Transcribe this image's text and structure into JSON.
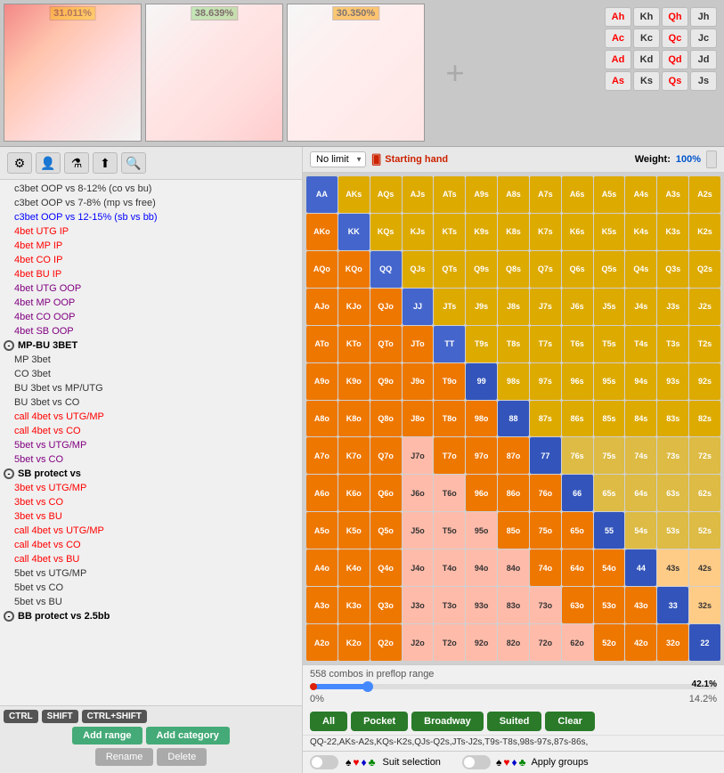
{
  "top": {
    "preview1_label": "31.011%",
    "preview2_label": "38.639%",
    "preview3_label": "30.350%",
    "add_btn": "+"
  },
  "cards": {
    "rows": [
      [
        "Ah",
        "Kh",
        "Qh",
        "Jh"
      ],
      [
        "Ac",
        "Kc",
        "Qc",
        "Jc"
      ],
      [
        "Ad",
        "Kd",
        "Qd",
        "Jd"
      ],
      [
        "As",
        "Ks",
        "Qs",
        "Js"
      ]
    ]
  },
  "toolbar": {
    "limit_label": "No limit",
    "starting_hand_icon": "🃏",
    "starting_hand_label": "Starting hand",
    "weight_label": "Weight:",
    "weight_value": "100%"
  },
  "sidebar": {
    "items": [
      {
        "label": "c3bet OOP vs 8-12% (co vs bu)",
        "color": "default",
        "indent": 1
      },
      {
        "label": "c3bet OOP vs 7-8% (mp vs free)",
        "color": "default",
        "indent": 1
      },
      {
        "label": "c3bet OOP vs 12-15% (sb vs bb)",
        "color": "blue",
        "indent": 1
      },
      {
        "label": "4bet UTG IP",
        "color": "red",
        "indent": 1
      },
      {
        "label": "4bet MP IP",
        "color": "red",
        "indent": 1
      },
      {
        "label": "4bet CO IP",
        "color": "red",
        "indent": 1
      },
      {
        "label": "4bet BU IP",
        "color": "red",
        "indent": 1
      },
      {
        "label": "4bet UTG OOP",
        "color": "purple",
        "indent": 1
      },
      {
        "label": "4bet MP OOP",
        "color": "purple",
        "indent": 1
      },
      {
        "label": "4bet CO OOP",
        "color": "purple",
        "indent": 1
      },
      {
        "label": "4bet SB OOP",
        "color": "purple",
        "indent": 1
      },
      {
        "label": "MP-BU 3BET",
        "color": "group",
        "indent": 0
      },
      {
        "label": "MP 3bet",
        "color": "default",
        "indent": 1
      },
      {
        "label": "CO 3bet",
        "color": "default",
        "indent": 1
      },
      {
        "label": "BU 3bet vs MP/UTG",
        "color": "default",
        "indent": 1
      },
      {
        "label": "BU 3bet vs CO",
        "color": "default",
        "indent": 1
      },
      {
        "label": "call 4bet vs UTG/MP",
        "color": "red",
        "indent": 1
      },
      {
        "label": "call 4bet vs CO",
        "color": "red",
        "indent": 1
      },
      {
        "label": "5bet vs UTG/MP",
        "color": "purple",
        "indent": 1
      },
      {
        "label": "5bet vs CO",
        "color": "purple",
        "indent": 1
      },
      {
        "label": "SB protect vs",
        "color": "group",
        "indent": 0
      },
      {
        "label": "3bet vs UTG/MP",
        "color": "red",
        "indent": 1
      },
      {
        "label": "3bet vs CO",
        "color": "red",
        "indent": 1
      },
      {
        "label": "3bet vs BU",
        "color": "red",
        "indent": 1
      },
      {
        "label": "call 4bet vs UTG/MP",
        "color": "red",
        "indent": 1
      },
      {
        "label": "call 4bet vs CO",
        "color": "red",
        "indent": 1
      },
      {
        "label": "call 4bet vs BU",
        "color": "red",
        "indent": 1
      },
      {
        "label": "5bet vs UTG/MP",
        "color": "default",
        "indent": 1
      },
      {
        "label": "5bet vs CO",
        "color": "default",
        "indent": 1
      },
      {
        "label": "5bet vs BU",
        "color": "default",
        "indent": 1
      },
      {
        "label": "BB protect vs 2.5bb",
        "color": "group",
        "indent": 0
      }
    ],
    "kbd_labels": [
      "CTRL",
      "SHIFT",
      "CTRL+SHIFT"
    ],
    "btn_add_range": "Add range",
    "btn_add_category": "Add category",
    "btn_rename": "Rename",
    "btn_delete": "Delete"
  },
  "grid": {
    "headers": [
      "AA",
      "AKs",
      "AQs",
      "AJs",
      "ATs",
      "A9s",
      "A8s",
      "A7s",
      "A6s",
      "A5s",
      "A4s",
      "A3s",
      "A2s",
      "AKo",
      "KK",
      "KQs",
      "KJs",
      "KTs",
      "K9s",
      "K8s",
      "K7s",
      "K6s",
      "K5s",
      "K4s",
      "K3s",
      "K2s",
      "AQo",
      "KQo",
      "QQ",
      "QJs",
      "QTs",
      "Q9s",
      "Q8s",
      "Q7s",
      "Q6s",
      "Q5s",
      "Q4s",
      "Q3s",
      "Q2s",
      "AJo",
      "KJo",
      "QJo",
      "JJ",
      "JTs",
      "J9s",
      "J8s",
      "J7s",
      "J6s",
      "J5s",
      "J4s",
      "J3s",
      "J2s",
      "ATo",
      "KTo",
      "QTo",
      "JTo",
      "TT",
      "T9s",
      "T8s",
      "T7s",
      "T6s",
      "T5s",
      "T4s",
      "T3s",
      "T2s",
      "A9o",
      "K9o",
      "Q9o",
      "J9o",
      "T9o",
      "99",
      "98s",
      "97s",
      "96s",
      "95s",
      "94s",
      "93s",
      "92s",
      "A8o",
      "K8o",
      "Q8o",
      "J8o",
      "T8o",
      "98o",
      "88",
      "87s",
      "86s",
      "85s",
      "84s",
      "83s",
      "82s",
      "A7o",
      "K7o",
      "Q7o",
      "J7o",
      "T7o",
      "97o",
      "87o",
      "77",
      "76s",
      "75s",
      "74s",
      "73s",
      "72s",
      "A6o",
      "K6o",
      "Q6o",
      "J6o",
      "T6o",
      "96o",
      "86o",
      "76o",
      "66",
      "65s",
      "64s",
      "63s",
      "62s",
      "A5o",
      "K5o",
      "Q5o",
      "J5o",
      "T5o",
      "95o",
      "85o",
      "75o",
      "65o",
      "55",
      "54s",
      "53s",
      "52s",
      "A4o",
      "K4o",
      "Q4o",
      "J4o",
      "T4o",
      "94o",
      "84o",
      "74o",
      "64o",
      "54o",
      "44",
      "43s",
      "42s",
      "A3o",
      "K3o",
      "Q3o",
      "J3o",
      "T3o",
      "93o",
      "83o",
      "73o",
      "63o",
      "53o",
      "43o",
      "33",
      "32s",
      "A2o",
      "K2o",
      "Q2o",
      "J2o",
      "T2o",
      "92o",
      "82o",
      "72o",
      "62o",
      "52o",
      "42o",
      "32o",
      "22"
    ],
    "cells": [
      "blue",
      "yellow",
      "yellow",
      "yellow",
      "yellow",
      "yellow",
      "yellow",
      "yellow",
      "yellow",
      "yellow",
      "yellow",
      "yellow",
      "yellow",
      "orange",
      "blue",
      "yellow",
      "yellow",
      "yellow",
      "yellow",
      "pink",
      "pink",
      "pink",
      "pink",
      "pink",
      "pink",
      "pink",
      "orange",
      "orange",
      "blue",
      "yellow",
      "yellow",
      "yellow",
      "yellow",
      "pink",
      "pink",
      "pink",
      "pink",
      "pink",
      "pink",
      "orange",
      "orange",
      "orange",
      "blue",
      "yellow",
      "yellow",
      "pink",
      "pink",
      "pink",
      "pink",
      "pink",
      "pink",
      "pink",
      "orange",
      "orange",
      "orange",
      "orange",
      "blue",
      "yellow",
      "yellow",
      "pink",
      "pink",
      "pink",
      "pink",
      "pink",
      "pink",
      "orange",
      "orange",
      "orange",
      "orange",
      "orange",
      "blue",
      "yellow",
      "yellow",
      "gray",
      "gray",
      "gray",
      "gray",
      "gray",
      "orange",
      "orange",
      "orange",
      "orange",
      "orange",
      "orange",
      "blue",
      "yellow",
      "yellow",
      "gray",
      "gray",
      "gray",
      "gray",
      "orange",
      "orange",
      "orange",
      "orange",
      "orange",
      "orange",
      "orange",
      "blue",
      "yellow",
      "yellow",
      "gray",
      "gray",
      "gray",
      "orange",
      "orange",
      "orange",
      "orange",
      "orange",
      "orange",
      "orange",
      "orange",
      "blue",
      "yellow",
      "yellow",
      "gray",
      "gray",
      "orange",
      "orange",
      "orange",
      "orange",
      "orange",
      "orange",
      "orange",
      "orange",
      "orange",
      "blue",
      "yellow",
      "yellow",
      "gray",
      "orange",
      "orange",
      "orange",
      "orange",
      "orange",
      "orange",
      "orange",
      "orange",
      "orange",
      "orange",
      "blue",
      "yellow",
      "yellow",
      "orange",
      "orange",
      "orange",
      "orange",
      "orange",
      "orange",
      "orange",
      "orange",
      "orange",
      "orange",
      "orange",
      "blue",
      "yellow",
      "orange",
      "orange",
      "orange",
      "orange",
      "orange",
      "orange",
      "orange",
      "orange",
      "orange",
      "orange",
      "orange",
      "orange",
      "blue"
    ]
  },
  "range": {
    "combos_text": "558 combos in preflop range",
    "pct_left": "0%",
    "pct_mid": "14.2%",
    "pct_right": "42.1%",
    "range_text": "QQ-22,AKs-A2s,KQs-K2s,QJs-Q2s,JTs-J2s,T9s-T8s,98s-97s,87s-86s,",
    "btn_all": "All",
    "btn_pocket": "Pocket",
    "btn_broadway": "Broadway",
    "btn_suited": "Suited",
    "btn_clear": "Clear"
  },
  "suit": {
    "toggle_suit": false,
    "suit_label": "Suit selection",
    "toggle_groups": false,
    "apply_label": "Apply groups"
  }
}
